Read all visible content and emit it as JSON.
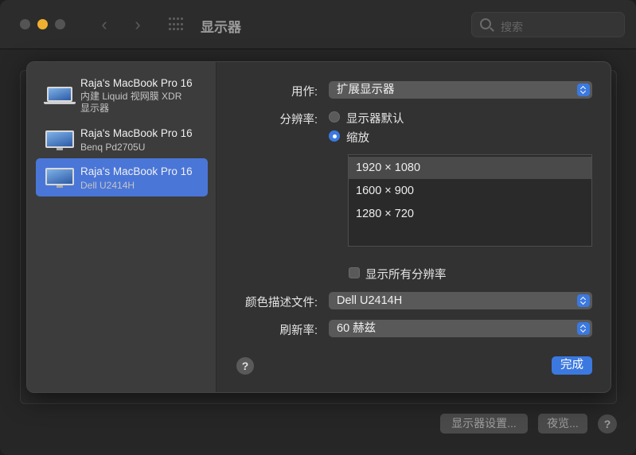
{
  "window": {
    "title": "显示器"
  },
  "search": {
    "placeholder": "搜索"
  },
  "background": {
    "display_settings_label": "显示器设置...",
    "night_shift_label": "夜览...",
    "help_label": "?"
  },
  "sidebar": {
    "items": [
      {
        "name": "Raja's MacBook Pro 16",
        "sub1": "内建 Liquid 视网膜 XDR",
        "sub2": "显示器",
        "icon": "laptop-icon",
        "selected": false
      },
      {
        "name": "Raja's MacBook Pro 16",
        "sub1": "Benq Pd2705U",
        "sub2": "",
        "icon": "monitor-icon",
        "selected": false
      },
      {
        "name": "Raja's MacBook Pro 16",
        "sub1": "Dell U2414H",
        "sub2": "",
        "icon": "monitor-icon",
        "selected": true
      }
    ]
  },
  "settings": {
    "use_as_label": "用作:",
    "use_as_value": "扩展显示器",
    "resolution_label": "分辨率:",
    "radio_default": "显示器默认",
    "radio_scaled": "缩放",
    "resolutions": [
      "1920 × 1080",
      "1600 × 900",
      "1280 × 720"
    ],
    "selected_resolution": "1920 × 1080",
    "show_all_label": "显示所有分辨率",
    "color_profile_label": "颜色描述文件:",
    "color_profile_value": "Dell U2414H",
    "refresh_label": "刷新率:",
    "refresh_value": "60 赫兹",
    "help_label": "?",
    "done_label": "完成"
  },
  "colors": {
    "accent": "#3b79e0",
    "selection": "#4a76d8"
  }
}
